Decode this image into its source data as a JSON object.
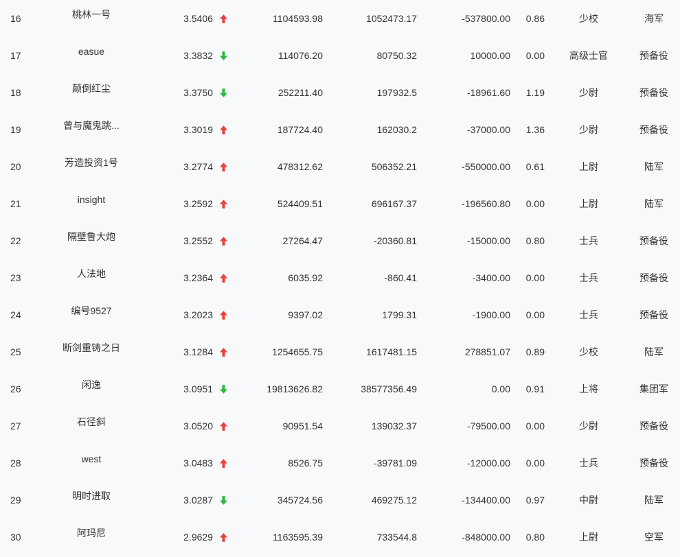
{
  "colors": {
    "up": "#e8413c",
    "down": "#2db83d",
    "text": "#333333",
    "background": "#f7f9fb"
  },
  "rows": [
    {
      "rank": "16",
      "name": "桃林一号",
      "score": "3.5406",
      "trend_icon": "arrow-up-icon",
      "value_a": "1104593.98",
      "value_b": "1052473.17",
      "value_c": "-537800.00",
      "ratio": "0.86",
      "title": "少校",
      "branch": "海军"
    },
    {
      "rank": "17",
      "name": "easue",
      "score": "3.3832",
      "trend_icon": "arrow-down-icon",
      "value_a": "114076.20",
      "value_b": "80750.32",
      "value_c": "10000.00",
      "ratio": "0.00",
      "title": "高级士官",
      "branch": "预备役"
    },
    {
      "rank": "18",
      "name": "颠倒红尘",
      "score": "3.3750",
      "trend_icon": "arrow-down-icon",
      "value_a": "252211.40",
      "value_b": "197932.5",
      "value_c": "-18961.60",
      "ratio": "1.19",
      "title": "少尉",
      "branch": "预备役"
    },
    {
      "rank": "19",
      "name": "曾与魔鬼跳...",
      "score": "3.3019",
      "trend_icon": "arrow-up-icon",
      "value_a": "187724.40",
      "value_b": "162030.2",
      "value_c": "-37000.00",
      "ratio": "1.36",
      "title": "少尉",
      "branch": "预备役"
    },
    {
      "rank": "20",
      "name": "芳造投资1号",
      "score": "3.2774",
      "trend_icon": "arrow-up-icon",
      "value_a": "478312.62",
      "value_b": "506352.21",
      "value_c": "-550000.00",
      "ratio": "0.61",
      "title": "上尉",
      "branch": "陆军"
    },
    {
      "rank": "21",
      "name": "insight",
      "score": "3.2592",
      "trend_icon": "arrow-up-icon",
      "value_a": "524409.51",
      "value_b": "696167.37",
      "value_c": "-196560.80",
      "ratio": "0.00",
      "title": "上尉",
      "branch": "陆军"
    },
    {
      "rank": "22",
      "name": "隔壁鲁大炮",
      "score": "3.2552",
      "trend_icon": "arrow-up-icon",
      "value_a": "27264.47",
      "value_b": "-20360.81",
      "value_c": "-15000.00",
      "ratio": "0.80",
      "title": "士兵",
      "branch": "预备役"
    },
    {
      "rank": "23",
      "name": "人法地",
      "score": "3.2364",
      "trend_icon": "arrow-up-icon",
      "value_a": "6035.92",
      "value_b": "-860.41",
      "value_c": "-3400.00",
      "ratio": "0.00",
      "title": "士兵",
      "branch": "预备役"
    },
    {
      "rank": "24",
      "name": "编号9527",
      "score": "3.2023",
      "trend_icon": "arrow-up-icon",
      "value_a": "9397.02",
      "value_b": "1799.31",
      "value_c": "-1900.00",
      "ratio": "0.00",
      "title": "士兵",
      "branch": "预备役"
    },
    {
      "rank": "25",
      "name": "断剑重铸之日",
      "score": "3.1284",
      "trend_icon": "arrow-up-icon",
      "value_a": "1254655.75",
      "value_b": "1617481.15",
      "value_c": "278851.07",
      "ratio": "0.89",
      "title": "少校",
      "branch": "陆军"
    },
    {
      "rank": "26",
      "name": "闲逸",
      "score": "3.0951",
      "trend_icon": "arrow-down-icon",
      "value_a": "19813626.82",
      "value_b": "38577356.49",
      "value_c": "0.00",
      "ratio": "0.91",
      "title": "上将",
      "branch": "集团军"
    },
    {
      "rank": "27",
      "name": "石径斜",
      "score": "3.0520",
      "trend_icon": "arrow-up-icon",
      "value_a": "90951.54",
      "value_b": "139032.37",
      "value_c": "-79500.00",
      "ratio": "0.00",
      "title": "少尉",
      "branch": "预备役"
    },
    {
      "rank": "28",
      "name": "west",
      "score": "3.0483",
      "trend_icon": "arrow-up-icon",
      "value_a": "8526.75",
      "value_b": "-39781.09",
      "value_c": "-12000.00",
      "ratio": "0.00",
      "title": "士兵",
      "branch": "预备役"
    },
    {
      "rank": "29",
      "name": "明时进取",
      "score": "3.0287",
      "trend_icon": "arrow-down-icon",
      "value_a": "345724.56",
      "value_b": "469275.12",
      "value_c": "-134400.00",
      "ratio": "0.97",
      "title": "中尉",
      "branch": "陆军"
    },
    {
      "rank": "30",
      "name": "阿玛尼",
      "score": "2.9629",
      "trend_icon": "arrow-up-icon",
      "value_a": "1163595.39",
      "value_b": "733544.8",
      "value_c": "-848000.00",
      "ratio": "0.80",
      "title": "上尉",
      "branch": "空军"
    }
  ]
}
